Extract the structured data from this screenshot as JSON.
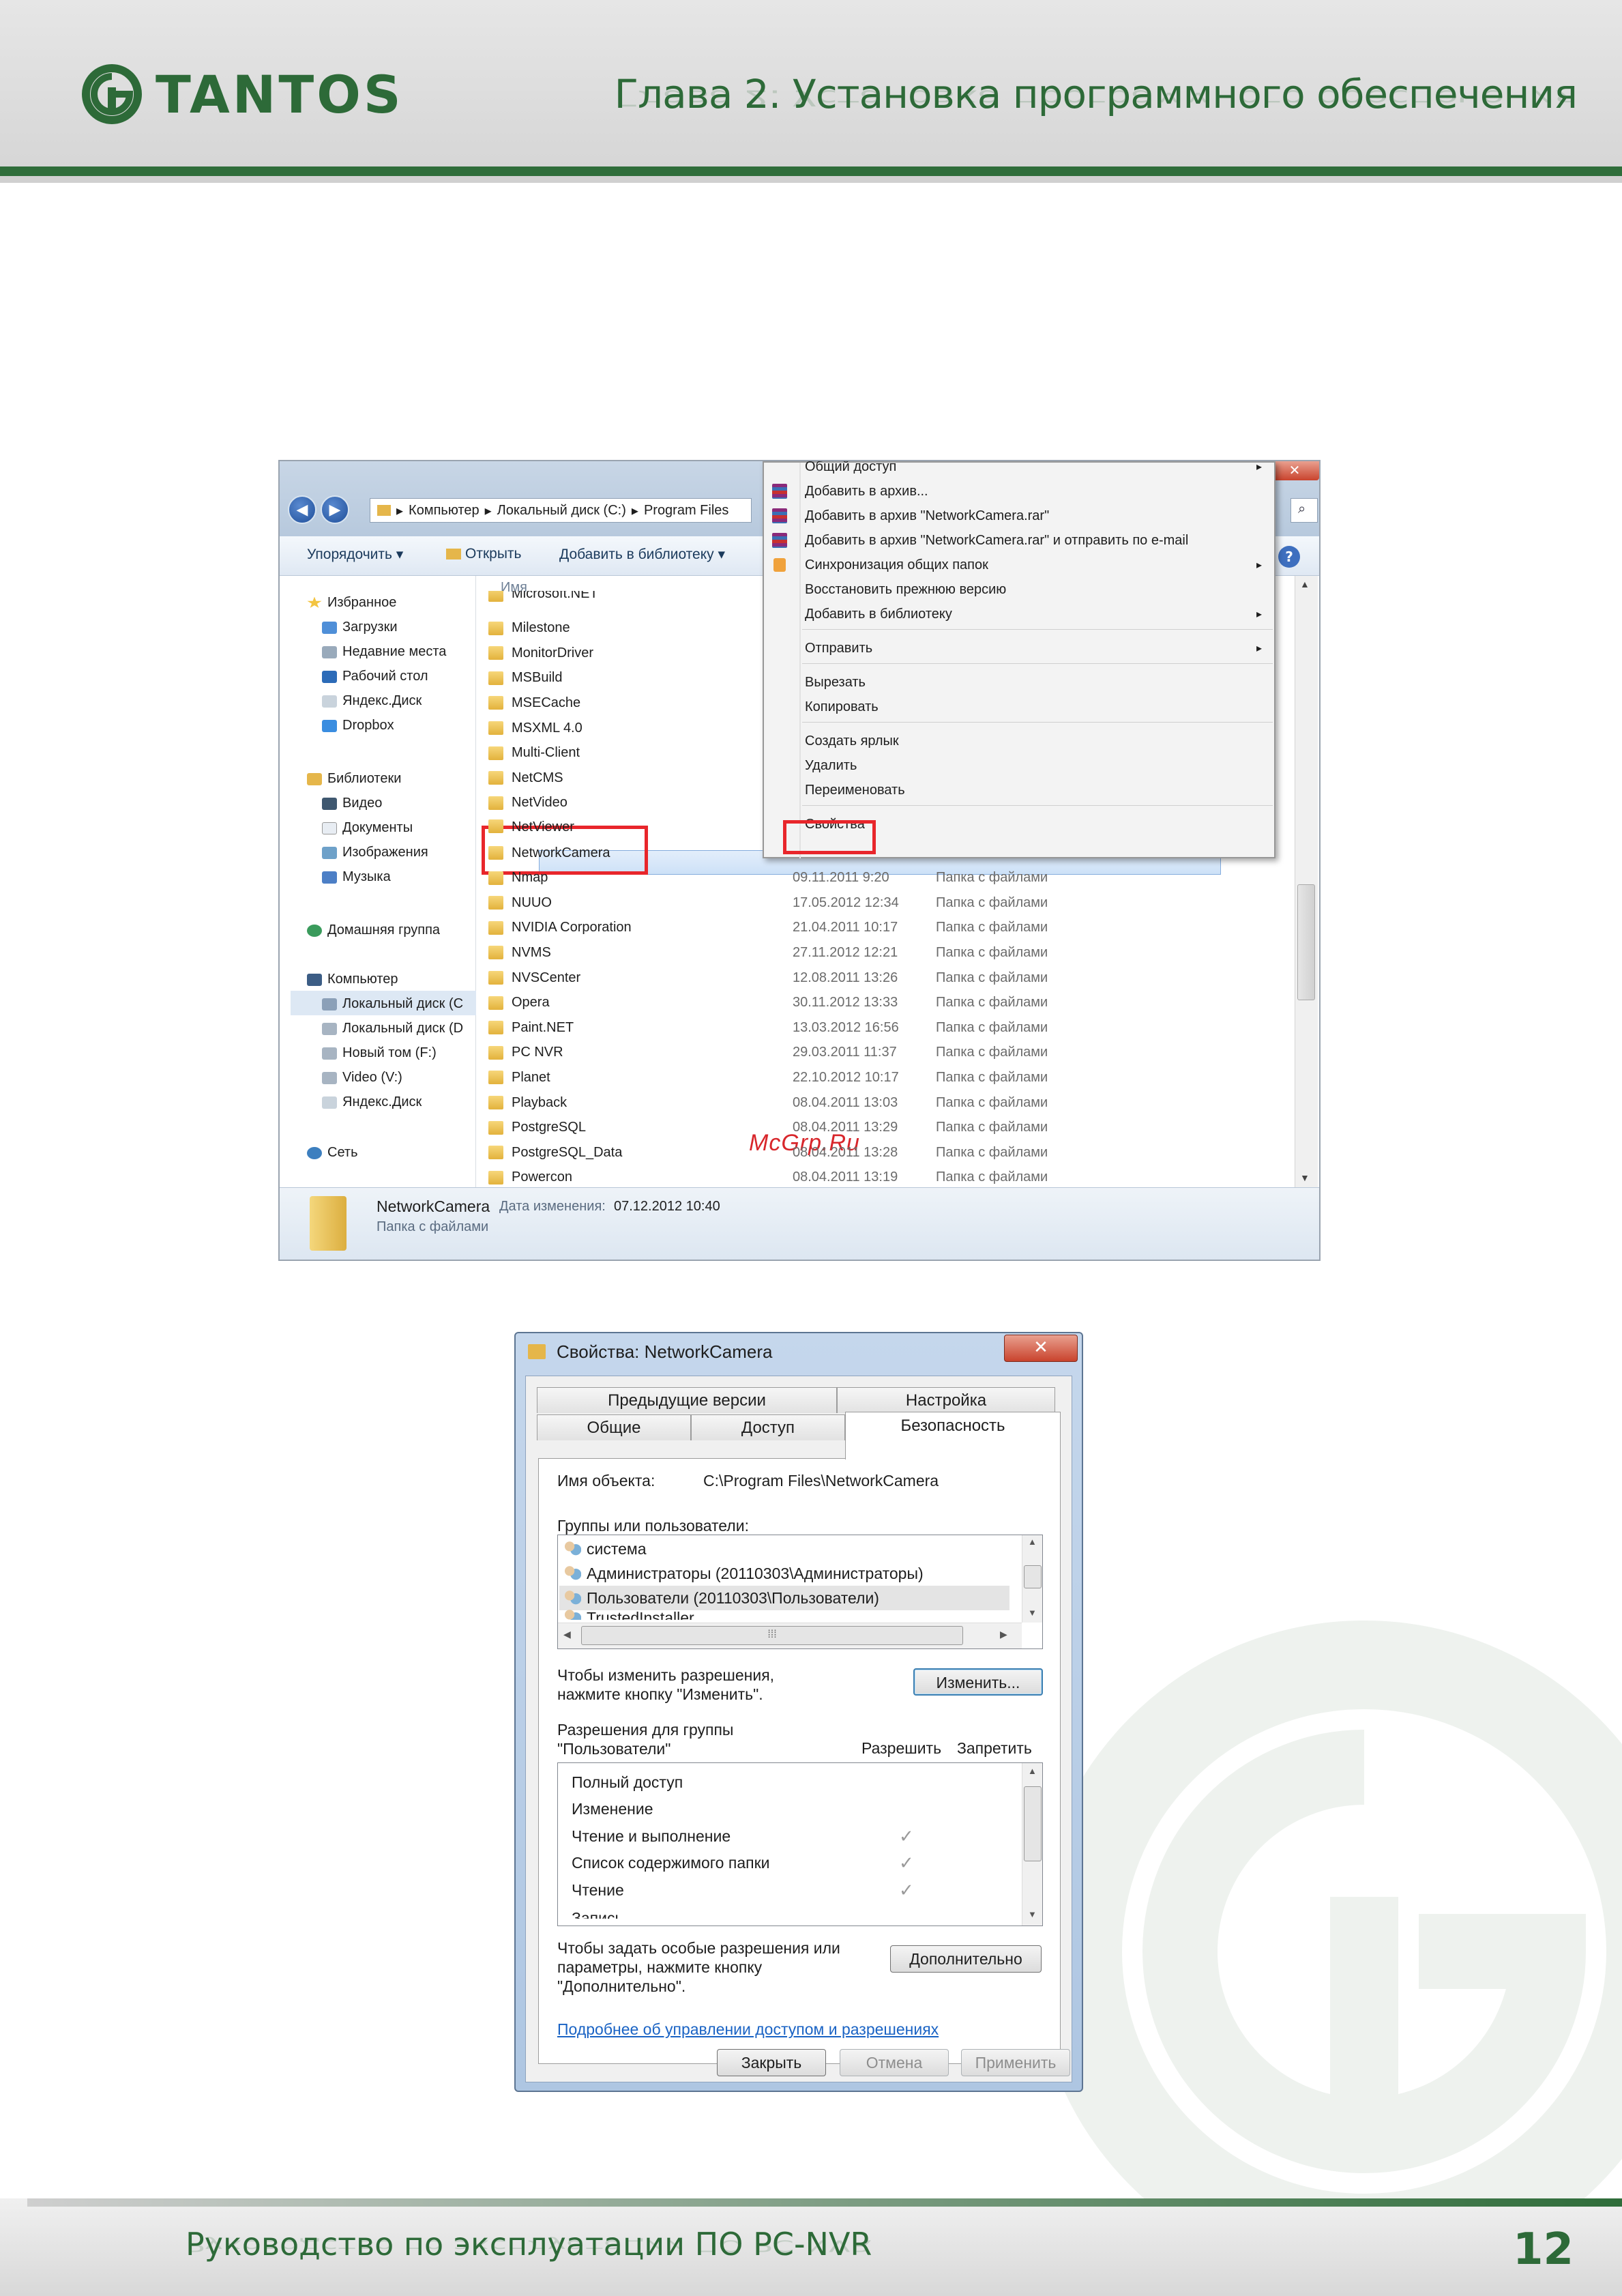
{
  "header": {
    "logo_text": "TANTOS",
    "chapter_title": "Глава 2. Установка программного обеспечения"
  },
  "footer": {
    "manual_title": "Руководство по эксплуатации ПО PC-NVR",
    "page_number": "12"
  },
  "explorer": {
    "breadcrumb": [
      "Компьютер",
      "Локальный диск (C:)",
      "Program Files"
    ],
    "toolbar": {
      "organize": "Упорядочить ▾",
      "open": "Открыть",
      "add_library": "Добавить в библиотеку ▾"
    },
    "column_name": "Имя",
    "nav": {
      "favorites": "Избранное",
      "downloads": "Загрузки",
      "recent": "Недавние места",
      "desktop": "Рабочий стол",
      "yandex": "Яндекс.Диск",
      "dropbox": "Dropbox",
      "libraries": "Библиотеки",
      "video": "Видео",
      "documents": "Документы",
      "images": "Изображения",
      "music": "Музыка",
      "homegroup": "Домашняя группа",
      "computer": "Компьютер",
      "disk_c": "Локальный диск (C",
      "disk_d": "Локальный диск (D",
      "disk_f": "Новый том (F:)",
      "disk_v": "Video (V:)",
      "yandex2": "Яндекс.Диск",
      "network": "Сеть"
    },
    "files": [
      {
        "name": "Microsoft.NET",
        "date": "",
        "type": ""
      },
      {
        "name": "Milestone",
        "date": "",
        "type": ""
      },
      {
        "name": "MonitorDriver",
        "date": "",
        "type": ""
      },
      {
        "name": "MSBuild",
        "date": "",
        "type": ""
      },
      {
        "name": "MSECache",
        "date": "",
        "type": ""
      },
      {
        "name": "MSXML 4.0",
        "date": "",
        "type": ""
      },
      {
        "name": "Multi-Client",
        "date": "",
        "type": ""
      },
      {
        "name": "NetCMS",
        "date": "",
        "type": ""
      },
      {
        "name": "NetVideo",
        "date": "",
        "type": ""
      },
      {
        "name": "NetViewer",
        "date": "",
        "type": ""
      },
      {
        "name": "NetworkCamera",
        "date": "",
        "type": ""
      },
      {
        "name": "Nmap",
        "date": "09.11.2011 9:20",
        "type": "Папка с файлами"
      },
      {
        "name": "NUUO",
        "date": "17.05.2012 12:34",
        "type": "Папка с файлами"
      },
      {
        "name": "NVIDIA Corporation",
        "date": "21.04.2011 10:17",
        "type": "Папка с файлами"
      },
      {
        "name": "NVMS",
        "date": "27.11.2012 12:21",
        "type": "Папка с файлами"
      },
      {
        "name": "NVSCenter",
        "date": "12.08.2011 13:26",
        "type": "Папка с файлами"
      },
      {
        "name": "Opera",
        "date": "30.11.2012 13:33",
        "type": "Папка с файлами"
      },
      {
        "name": "Paint.NET",
        "date": "13.03.2012 16:56",
        "type": "Папка с файлами"
      },
      {
        "name": "PC NVR",
        "date": "29.03.2011 11:37",
        "type": "Папка с файлами"
      },
      {
        "name": "Planet",
        "date": "22.10.2012 10:17",
        "type": "Папка с файлами"
      },
      {
        "name": "Playback",
        "date": "08.04.2011 13:03",
        "type": "Папка с файлами"
      },
      {
        "name": "PostgreSQL",
        "date": "08.04.2011 13:29",
        "type": "Папка с файлами"
      },
      {
        "name": "PostgreSQL_Data",
        "date": "08.04.2011 13:28",
        "type": "Папка с файлами"
      },
      {
        "name": "Powercon",
        "date": "08.04.2011 13:19",
        "type": "Папка с файлами"
      }
    ],
    "context_menu": [
      "Общий доступ",
      "Добавить в архив...",
      "Добавить в архив \"NetworkCamera.rar\"",
      "Добавить в архив \"NetworkCamera.rar\" и отправить по e-mail",
      "Синхронизация общих папок",
      "Восстановить прежнюю версию",
      "Добавить в библиотеку",
      "Отправить",
      "Вырезать",
      "Копировать",
      "Создать ярлык",
      "Удалить",
      "Переименовать",
      "Свойства"
    ],
    "status": {
      "name": "NetworkCamera",
      "modified_label": "Дата изменения:",
      "modified": "07.12.2012 10:40",
      "type": "Папка с файлами"
    },
    "watermark": "McGrp.Ru"
  },
  "dialog": {
    "title": "Свойства: NetworkCamera",
    "tabs": {
      "prev_versions": "Предыдущие версии",
      "settings": "Настройка",
      "general": "Общие",
      "access": "Доступ",
      "security": "Безопасность"
    },
    "object_label": "Имя объекта:",
    "object_value": "C:\\Program Files\\NetworkCamera",
    "groups_label": "Группы или пользователи:",
    "users": [
      "система",
      "Администраторы (20110303\\Администраторы)",
      "Пользователи (20110303\\Пользователи)",
      "TrustedInstaller"
    ],
    "change_hint": "Чтобы изменить разрешения, нажмите кнопку \"Изменить\".",
    "change_btn": "Изменить...",
    "perm_label": "Разрешения для группы \"Пользователи\"",
    "allow": "Разрешить",
    "deny": "Запретить",
    "permissions": [
      {
        "name": "Полный доступ",
        "allow": false
      },
      {
        "name": "Изменение",
        "allow": false
      },
      {
        "name": "Чтение и выполнение",
        "allow": true
      },
      {
        "name": "Список содержимого папки",
        "allow": true
      },
      {
        "name": "Чтение",
        "allow": true
      },
      {
        "name": "Запись",
        "allow": false
      }
    ],
    "advanced_hint": "Чтобы задать особые разрешения или параметры, нажмите кнопку \"Дополнительно\".",
    "advanced_btn": "Дополнительно",
    "link": "Подробнее об управлении доступом и разрешениях",
    "close_btn": "Закрыть",
    "cancel_btn": "Отмена",
    "apply_btn": "Применить",
    "close_x": "✕"
  },
  "colors": {
    "brand_green": "#2d6a38",
    "highlight_red": "#e8262b"
  }
}
